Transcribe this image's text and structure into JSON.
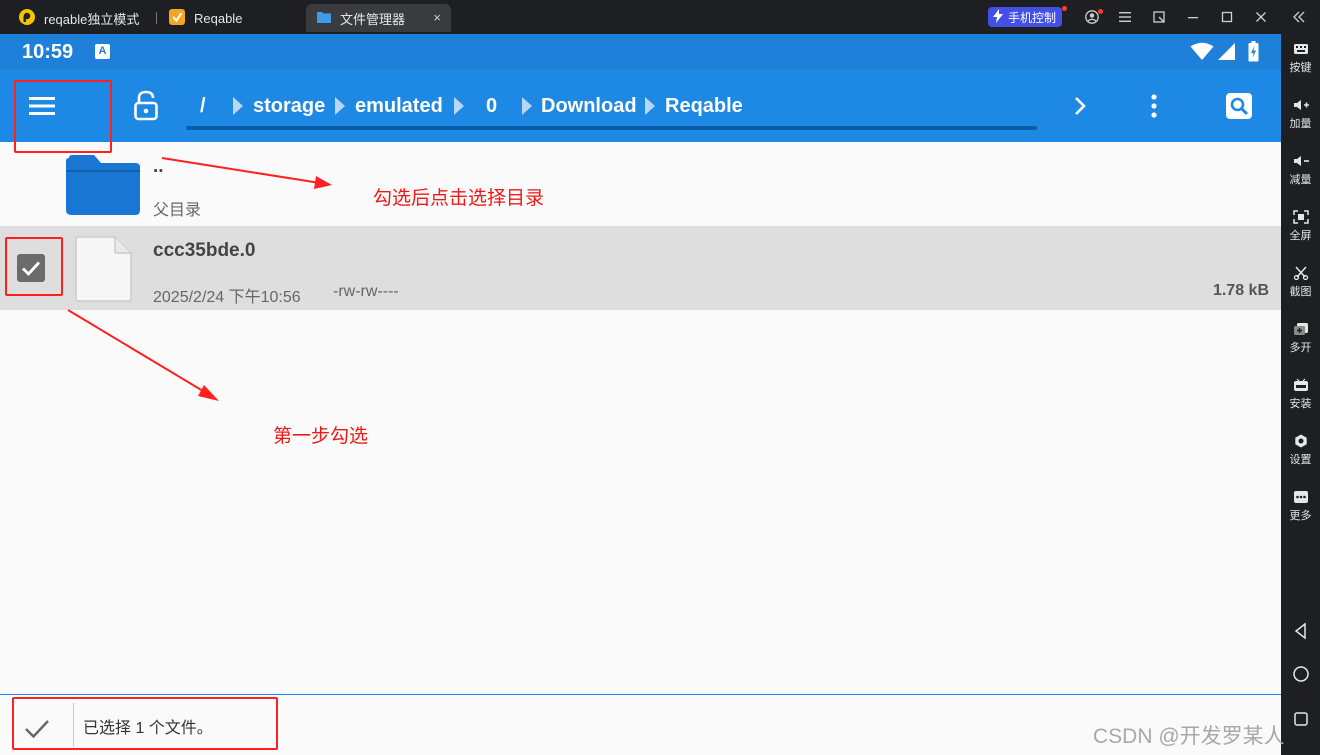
{
  "window": {
    "tabs": [
      {
        "label": "reqable独立模式"
      },
      {
        "label": "Reqable"
      },
      {
        "label": "文件管理器"
      }
    ],
    "phone_control_label": "手机控制",
    "close_glyph": "×"
  },
  "sidebar": {
    "items": [
      {
        "label": "按键",
        "icon": "keyboard-icon"
      },
      {
        "label": "加量",
        "icon": "volume-up-icon"
      },
      {
        "label": "减量",
        "icon": "volume-down-icon"
      },
      {
        "label": "全屏",
        "icon": "fullscreen-icon"
      },
      {
        "label": "截图",
        "icon": "scissors-icon"
      },
      {
        "label": "多开",
        "icon": "multi-instance-icon"
      },
      {
        "label": "安装",
        "icon": "apk-install-icon"
      },
      {
        "label": "设置",
        "icon": "settings-icon"
      },
      {
        "label": "更多",
        "icon": "more-icon"
      }
    ]
  },
  "status_bar": {
    "time": "10:59",
    "badge": "A"
  },
  "app_bar": {
    "path": [
      "/",
      "storage",
      "emulated",
      "0",
      "Download",
      "Reqable"
    ]
  },
  "files": [
    {
      "name": "..",
      "subtitle": "父目录",
      "type": "folder",
      "selected": false
    },
    {
      "name": "ccc35bde.0",
      "date": "2025/2/24 下午10:56",
      "permissions": "-rw-rw----",
      "size": "1.78 kB",
      "type": "file",
      "selected": true
    }
  ],
  "bottom_bar": {
    "status": "已选择 1 个文件。"
  },
  "annotations": {
    "step2": "勾选后点击选择目录",
    "step1": "第一步勾选"
  },
  "watermark": "CSDN @开发罗某人",
  "colors": {
    "accent": "#1e88e5",
    "status_bar": "#1e80d8",
    "annotation_red": "#ff2020",
    "selected_row": "#dedede",
    "chrome": "#1e1f22"
  }
}
